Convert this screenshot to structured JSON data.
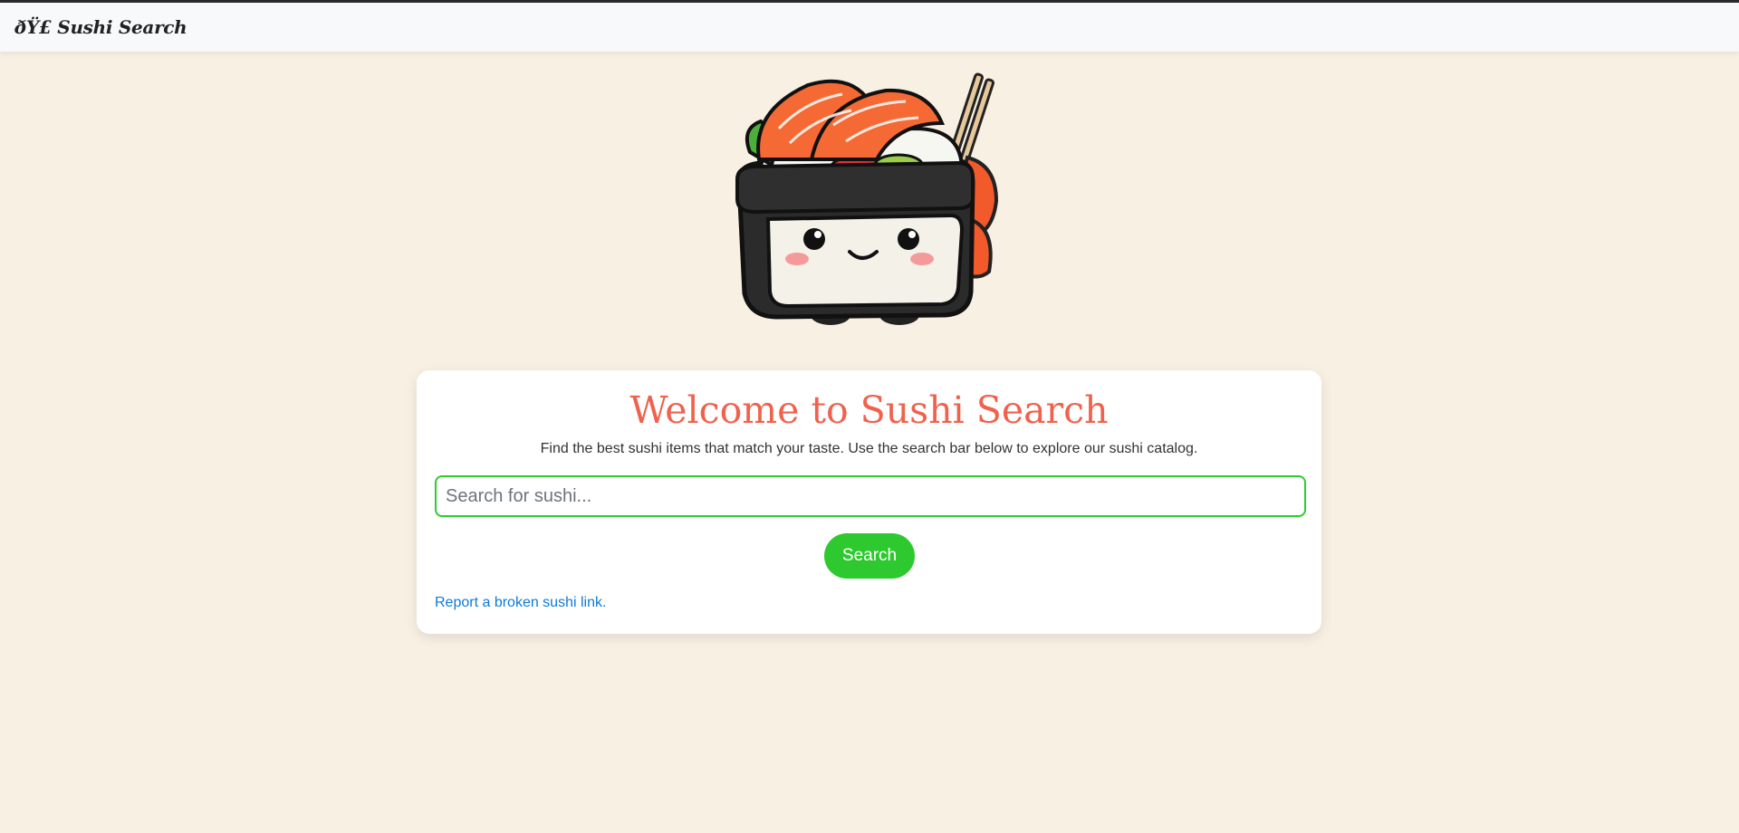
{
  "navbar": {
    "brand": "ðŸ£ Sushi Search"
  },
  "hero": {
    "image": "sushi-mascot-illustration"
  },
  "main": {
    "title": "Welcome to Sushi Search",
    "subtitle": "Find the best sushi items that match your taste. Use the search bar below to explore our sushi catalog.",
    "search": {
      "placeholder": "Search for sushi...",
      "value": ""
    },
    "search_button": "Search",
    "report_link": "Report a broken sushi link."
  },
  "colors": {
    "page_background": "#f8f0e3",
    "title": "#f0624d",
    "accent_green": "#2ec92e",
    "link": "#0d7ad8"
  }
}
